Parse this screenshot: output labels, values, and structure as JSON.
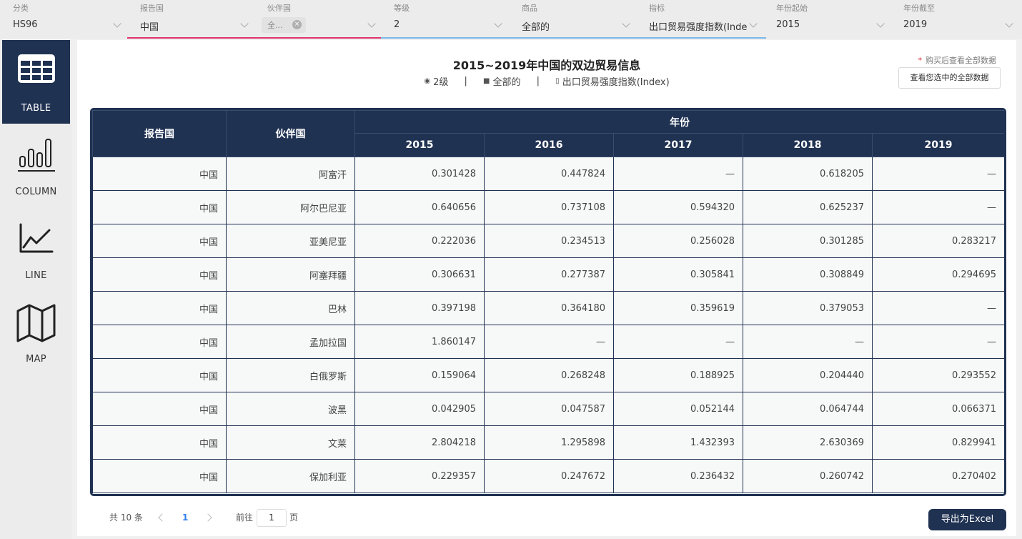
{
  "filters": [
    {
      "label": "分类",
      "value": "HS96",
      "accent": ""
    },
    {
      "label": "报告国",
      "value": "中国",
      "accent": "#e0326e"
    },
    {
      "label": "伙伴国",
      "value": "",
      "accent": "#e0326e"
    },
    {
      "label": "等级",
      "value": "2",
      "accent": "#7ab8e8"
    },
    {
      "label": "商品",
      "value": "全部的",
      "accent": "#7ab8e8"
    },
    {
      "label": "指标",
      "value": "出口贸易强度指数(Inde",
      "accent": "#7ab8e8"
    },
    {
      "label": "年份起始",
      "value": "2015",
      "accent": ""
    },
    {
      "label": "年份截至",
      "value": "2019",
      "accent": ""
    }
  ],
  "partner_tag": {
    "text": "全...",
    "clear_glyph": "×"
  },
  "sidebar": [
    {
      "label": "TABLE",
      "icon": "table-icon",
      "active": true
    },
    {
      "label": "COLUMN",
      "icon": "column-chart-icon",
      "active": false
    },
    {
      "label": "LINE",
      "icon": "line-chart-icon",
      "active": false
    },
    {
      "label": "MAP",
      "icon": "map-icon",
      "active": false
    }
  ],
  "header": {
    "title": "2015~2019年中国的双边贸易信息",
    "level": "2级",
    "product": "全部的",
    "indicator": "出口贸易强度指数(Index)",
    "separator": "|",
    "note": "购买后查看全部数据",
    "note_mark": "*",
    "view_all_label": "查看您选中的全部数据"
  },
  "table": {
    "col_reporter": "报告国",
    "col_partner": "伙伴国",
    "col_year_group": "年份",
    "years": [
      "2015",
      "2016",
      "2017",
      "2018",
      "2019"
    ],
    "rows": [
      {
        "reporter": "中国",
        "partner": "阿富汗",
        "values": [
          "0.301428",
          "0.447824",
          "—",
          "0.618205",
          "—"
        ]
      },
      {
        "reporter": "中国",
        "partner": "阿尔巴尼亚",
        "values": [
          "0.640656",
          "0.737108",
          "0.594320",
          "0.625237",
          "—"
        ]
      },
      {
        "reporter": "中国",
        "partner": "亚美尼亚",
        "values": [
          "0.222036",
          "0.234513",
          "0.256028",
          "0.301285",
          "0.283217"
        ]
      },
      {
        "reporter": "中国",
        "partner": "阿塞拜疆",
        "values": [
          "0.306631",
          "0.277387",
          "0.305841",
          "0.308849",
          "0.294695"
        ]
      },
      {
        "reporter": "中国",
        "partner": "巴林",
        "values": [
          "0.397198",
          "0.364180",
          "0.359619",
          "0.379053",
          "—"
        ]
      },
      {
        "reporter": "中国",
        "partner": "孟加拉国",
        "values": [
          "1.860147",
          "—",
          "—",
          "—",
          "—"
        ]
      },
      {
        "reporter": "中国",
        "partner": "白俄罗斯",
        "values": [
          "0.159064",
          "0.268248",
          "0.188925",
          "0.204440",
          "0.293552"
        ]
      },
      {
        "reporter": "中国",
        "partner": "波黑",
        "values": [
          "0.042905",
          "0.047587",
          "0.052144",
          "0.064744",
          "0.066371"
        ]
      },
      {
        "reporter": "中国",
        "partner": "文莱",
        "values": [
          "2.804218",
          "1.295898",
          "1.432393",
          "2.630369",
          "0.829941"
        ]
      },
      {
        "reporter": "中国",
        "partner": "保加利亚",
        "values": [
          "0.229357",
          "0.247672",
          "0.236432",
          "0.260742",
          "0.270402"
        ]
      }
    ]
  },
  "pagination": {
    "total": "共 10 条",
    "current_page": "1",
    "goto_label": "前往",
    "goto_value": "1",
    "page_suffix": "页"
  },
  "export_label": "导出为Excel",
  "colors": {
    "navy": "#203252",
    "accent_pink": "#e0326e",
    "accent_blue": "#7ab8e8",
    "link_blue": "#2f7ff0",
    "required_red": "#e0313a"
  }
}
